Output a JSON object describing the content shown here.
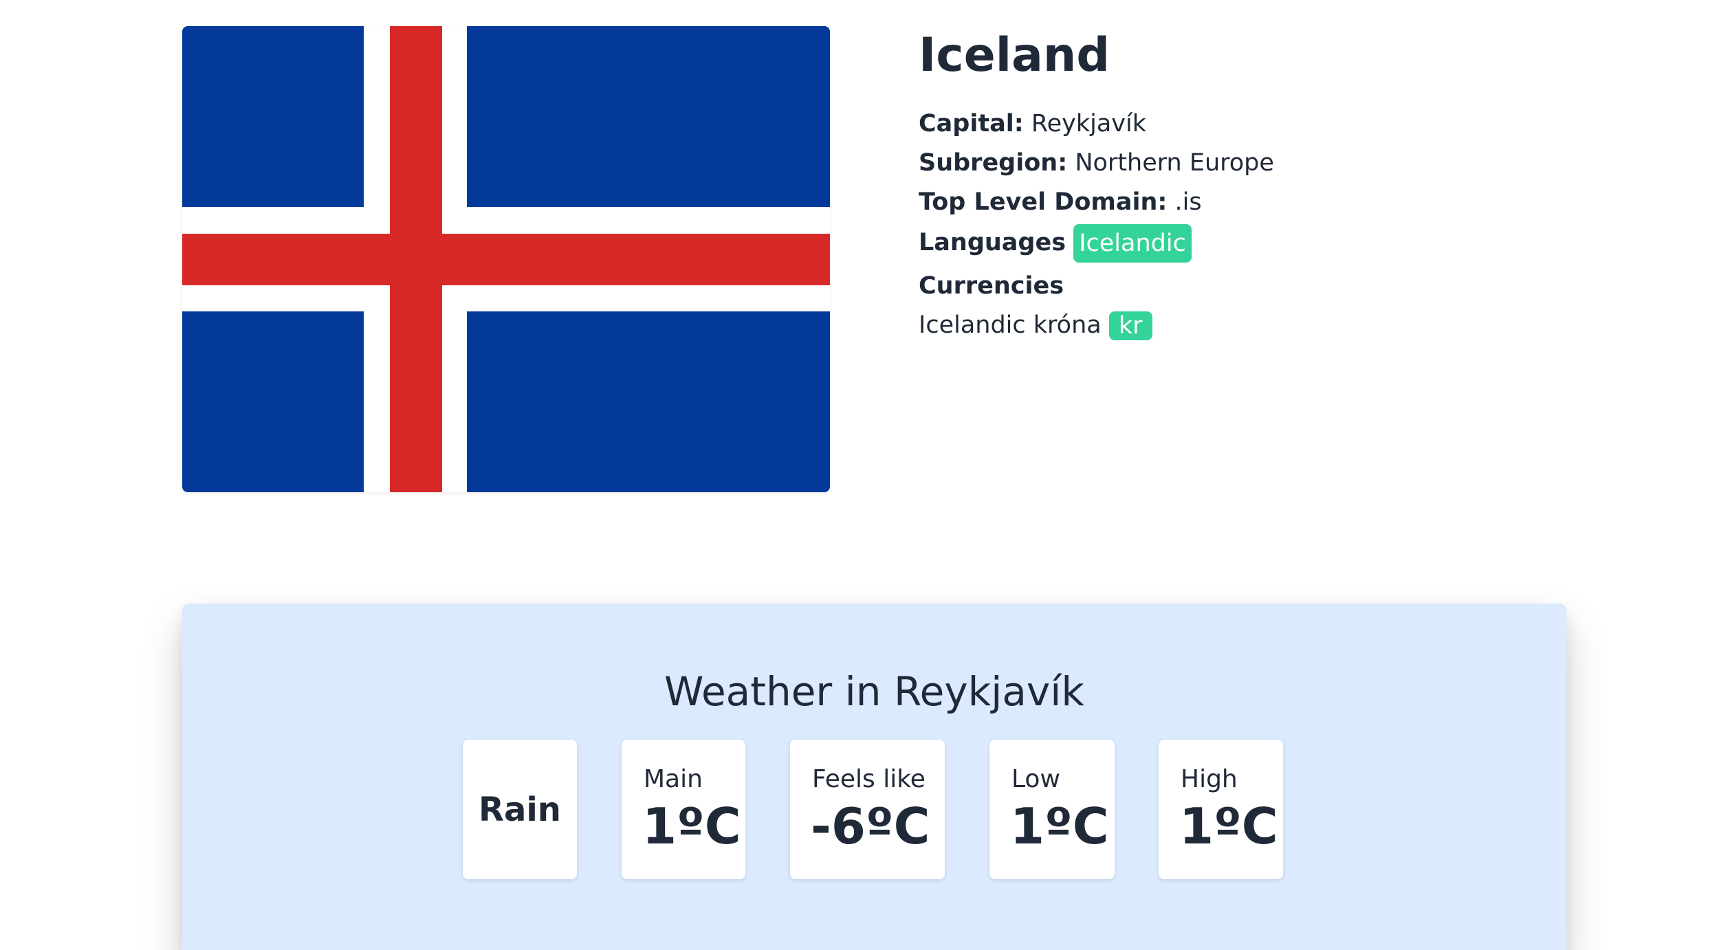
{
  "country": {
    "name": "Iceland",
    "capital_label": "Capital:",
    "capital": "Reykjavík",
    "subregion_label": "Subregion:",
    "subregion": "Northern Europe",
    "tld_label": "Top Level Domain:",
    "tld": ".is",
    "languages_label": "Languages",
    "languages": [
      "Icelandic"
    ],
    "currencies_label": "Currencies",
    "currency_name": "Icelandic króna",
    "currency_symbol": "kr"
  },
  "flag": {
    "colors": {
      "blue": "#02399b",
      "white": "#ffffff",
      "red": "#d72a28"
    }
  },
  "weather": {
    "title": "Weather in Reykjavík",
    "condition": "Rain",
    "cards": [
      {
        "label": "Main",
        "value": "1ºC"
      },
      {
        "label": "Feels like",
        "value": "-6ºC"
      },
      {
        "label": "Low",
        "value": "1ºC"
      },
      {
        "label": "High",
        "value": "1ºC"
      }
    ]
  },
  "colors": {
    "badge": "#34d399",
    "weather_panel": "#dbeafe",
    "text": "#1f2937"
  }
}
